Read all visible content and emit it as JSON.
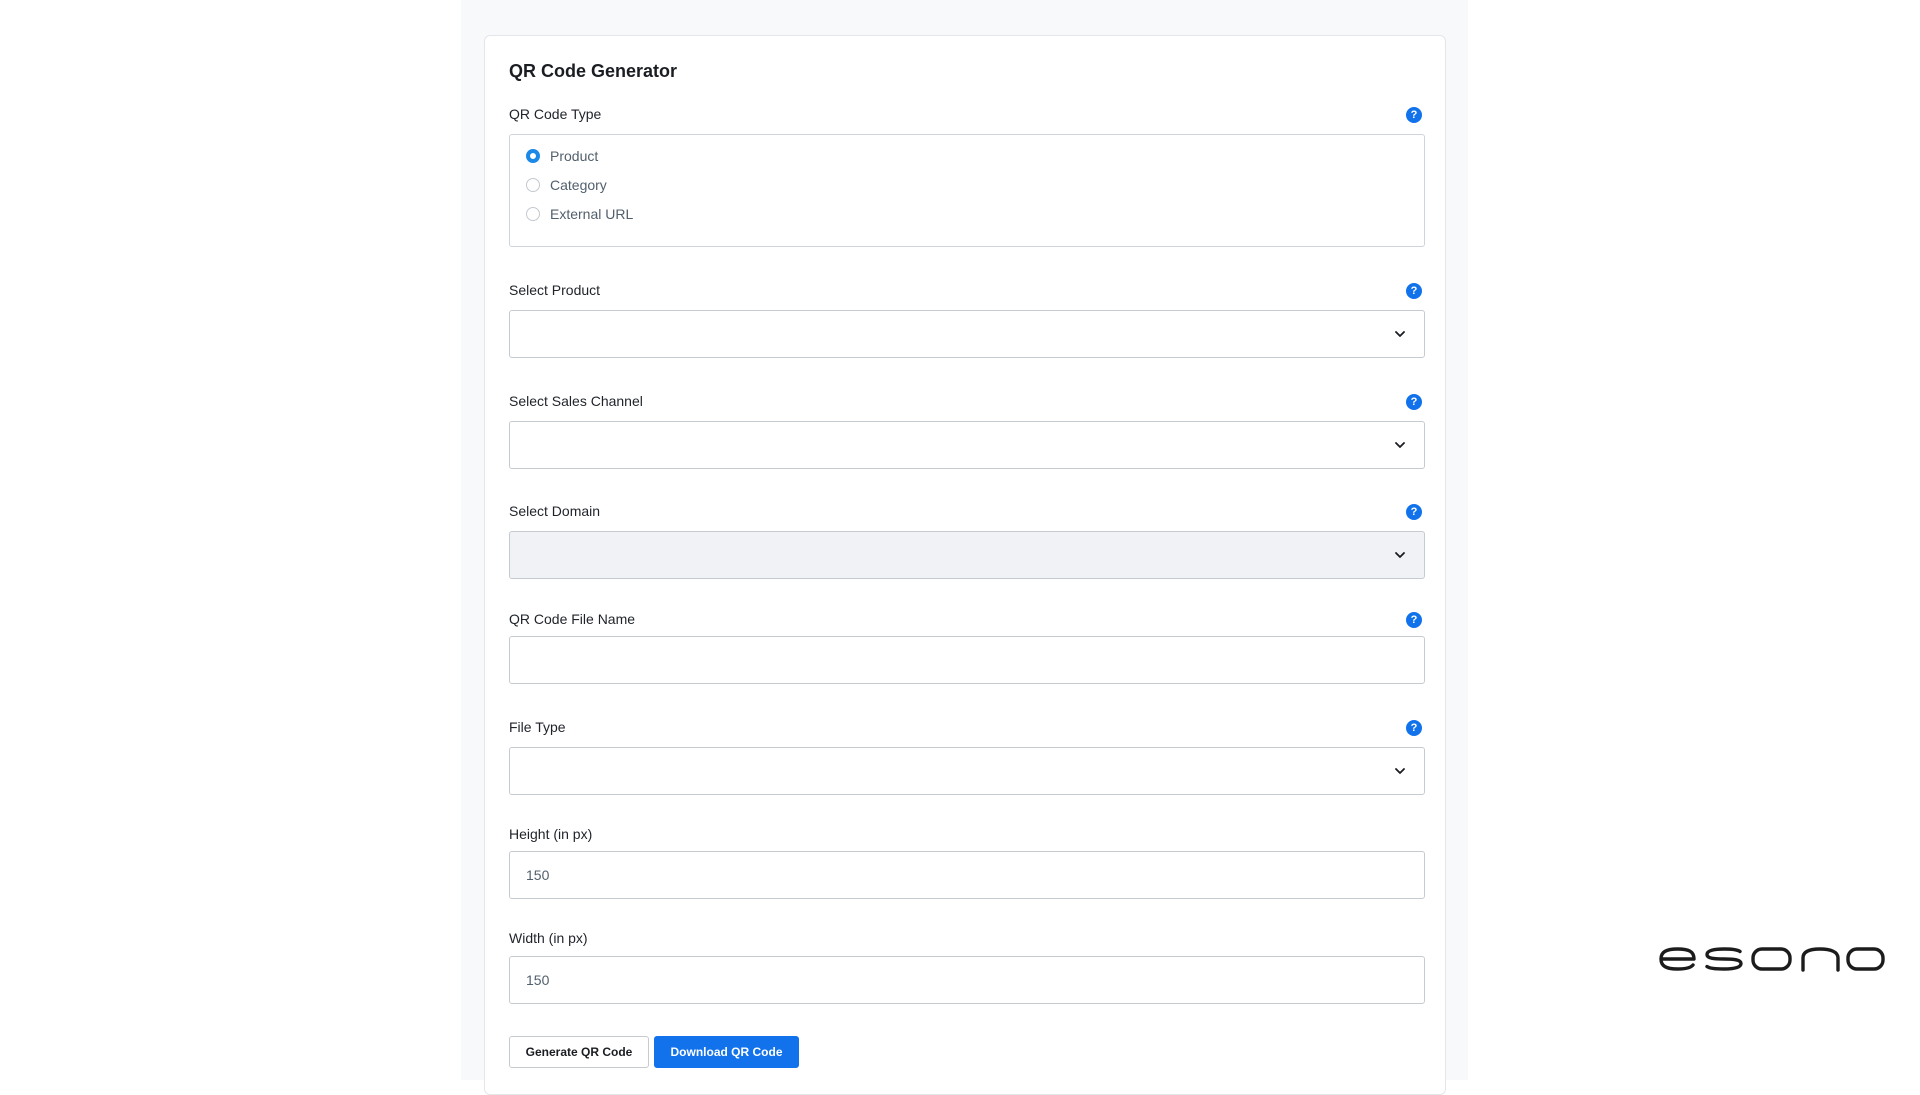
{
  "card": {
    "title": "QR Code Generator"
  },
  "help_icon_glyph": "?",
  "qr_type": {
    "label": "QR Code Type",
    "options": [
      {
        "label": "Product",
        "checked": true
      },
      {
        "label": "Category",
        "checked": false
      },
      {
        "label": "External URL",
        "checked": false
      }
    ]
  },
  "select_product": {
    "label": "Select Product",
    "value": ""
  },
  "select_sales_channel": {
    "label": "Select Sales Channel",
    "value": ""
  },
  "select_domain": {
    "label": "Select Domain",
    "value": "",
    "disabled": true
  },
  "file_name": {
    "label": "QR Code File Name",
    "value": ""
  },
  "file_type": {
    "label": "File Type",
    "value": ""
  },
  "height": {
    "label": "Height (in px)",
    "value": "150"
  },
  "width": {
    "label": "Width (in px)",
    "value": "150"
  },
  "buttons": {
    "generate": "Generate QR Code",
    "download": "Download QR Code"
  },
  "colors": {
    "primary": "#1172eb",
    "radio_checked": "#1a89e8",
    "disabled_bg": "#f1f2f5"
  },
  "icons": {
    "help": "question-circle-icon",
    "dropdown": "chevron-down-icon",
    "brand": "esono-logo"
  },
  "brand": {
    "logo_text": "esono"
  }
}
